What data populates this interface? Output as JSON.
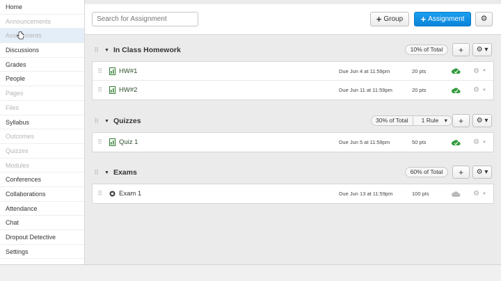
{
  "sidebar": {
    "items": [
      {
        "label": "Home",
        "state": "normal"
      },
      {
        "label": "Announcements",
        "state": "disabled"
      },
      {
        "label": "Assignments",
        "state": "active"
      },
      {
        "label": "Discussions",
        "state": "normal"
      },
      {
        "label": "Grades",
        "state": "normal"
      },
      {
        "label": "People",
        "state": "normal"
      },
      {
        "label": "Pages",
        "state": "disabled"
      },
      {
        "label": "Files",
        "state": "disabled"
      },
      {
        "label": "Syllabus",
        "state": "normal"
      },
      {
        "label": "Outcomes",
        "state": "disabled"
      },
      {
        "label": "Quizzes",
        "state": "disabled"
      },
      {
        "label": "Modules",
        "state": "disabled"
      },
      {
        "label": "Conferences",
        "state": "normal"
      },
      {
        "label": "Collaborations",
        "state": "normal"
      },
      {
        "label": "Attendance",
        "state": "normal"
      },
      {
        "label": "Chat",
        "state": "normal"
      },
      {
        "label": "Dropout Detective",
        "state": "normal"
      },
      {
        "label": "Settings",
        "state": "normal"
      }
    ]
  },
  "toolbar": {
    "search_placeholder": "Search for Assignment",
    "group_button": "Group",
    "assignment_button": "Assignment"
  },
  "groups": [
    {
      "title": "In Class Homework",
      "weight": "10% of Total",
      "rules": "",
      "items": [
        {
          "title": "HW#1",
          "due": "Due Jun 4 at 11:59pm",
          "points": "20 pts",
          "type": "assignment",
          "published": true
        },
        {
          "title": "HW#2",
          "due": "Due Jun 11 at 11:59pm",
          "points": "20 pts",
          "type": "assignment",
          "published": true
        }
      ]
    },
    {
      "title": "Quizzes",
      "weight": "30% of Total",
      "rules": "1 Rule",
      "items": [
        {
          "title": "Quiz 1",
          "due": "Due Jun 5 at 11:59pm",
          "points": "50 pts",
          "type": "assignment",
          "published": true
        }
      ]
    },
    {
      "title": "Exams",
      "weight": "60% of Total",
      "rules": "",
      "items": [
        {
          "title": "Exam 1",
          "due": "Due Jun 13 at 11:59pm",
          "points": "100 pts",
          "type": "quiz",
          "published": false
        }
      ]
    }
  ],
  "colors": {
    "primary": "#0a85d8",
    "published": "#2e9b3a",
    "unpublished": "#b9b9b9",
    "active_nav": "#e3eef9"
  }
}
